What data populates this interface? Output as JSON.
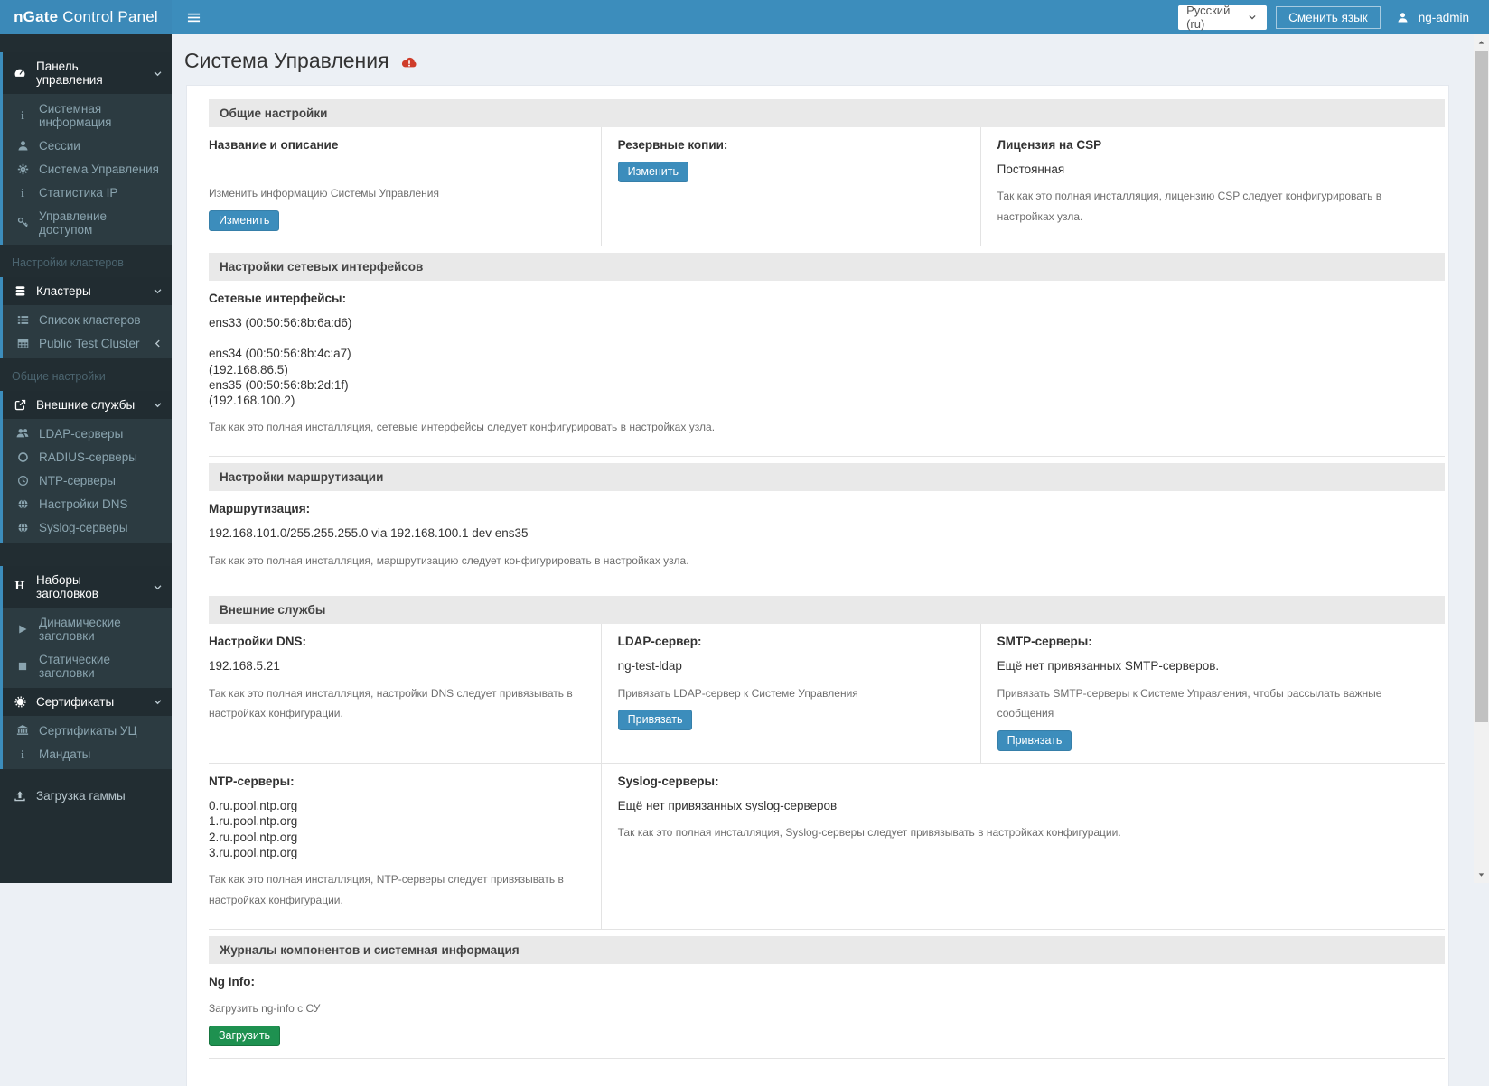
{
  "navbar": {
    "brand_bold": "nGate",
    "brand_rest": "Control Panel",
    "language_select_value": "Русский (ru)",
    "change_language_label": "Сменить язык",
    "username": "ng-admin"
  },
  "icons": {
    "menu": "hamburger-menu",
    "title_status": "red-cloud-warning",
    "navbar_user": "person-silhouette"
  },
  "sidebar": {
    "dashboard": {
      "label": "Панель управления",
      "items": [
        "Системная информация",
        "Сессии",
        "Система Управления",
        "Статистика IP",
        "Управление доступом"
      ]
    },
    "clusters_header": "Настройки кластеров",
    "clusters": {
      "label": "Кластеры",
      "items": [
        "Список кластеров",
        "Public Test Cluster"
      ]
    },
    "general_header": "Общие настройки",
    "external": {
      "label": "Внешние службы",
      "items": [
        "LDAP-серверы",
        "RADIUS-серверы",
        "NTP-серверы",
        "Настройки DNS",
        "Syslog-серверы"
      ]
    },
    "header_sets": {
      "label": "Наборы заголовков",
      "items": [
        "Динамические заголовки",
        "Статические заголовки"
      ]
    },
    "certificates": {
      "label": "Сертификаты",
      "items": [
        "Сертификаты УЦ",
        "Мандаты"
      ]
    },
    "gamma_upload": "Загрузка гаммы"
  },
  "page": {
    "title": "Система Управления"
  },
  "sections": {
    "general": {
      "header": "Общие настройки",
      "name_desc": {
        "title": "Название и описание",
        "hint": "Изменить информацию Системы Управления",
        "button": "Изменить"
      },
      "backups": {
        "title": "Резервные копии:",
        "button": "Изменить"
      },
      "csp_license": {
        "title": "Лицензия на CSP",
        "value": "Постоянная",
        "note": "Так как это полная инсталляция, лицензию CSP следует конфигурировать в настройках узла."
      }
    },
    "network": {
      "header": "Настройки сетевых интерфейсов",
      "title": "Сетевые интерфейсы:",
      "interfaces": "ens33 (00:50:56:8b:6a:d6)\n\nens34 (00:50:56:8b:4c:a7)\n(192.168.86.5)\nens35 (00:50:56:8b:2d:1f)\n(192.168.100.2)",
      "note": "Так как это полная инсталляция, сетевые интерфейсы следует конфигурировать в настройках узла."
    },
    "routing": {
      "header": "Настройки маршрутизации",
      "title": "Маршрутизация:",
      "route": "192.168.101.0/255.255.255.0 via 192.168.100.1 dev ens35",
      "note": "Так как это полная инсталляция, маршрутизацию следует конфигурировать в настройках узла."
    },
    "external_services": {
      "header": "Внешние службы",
      "dns": {
        "title": "Настройки DNS:",
        "value": "192.168.5.21",
        "note": "Так как это полная инсталляция, настройки DNS следует привязывать в настройках конфигурации."
      },
      "ldap": {
        "title": "LDAP-сервер:",
        "value": "ng-test-ldap",
        "note": "Привязать LDAP-сервер к Системе Управления",
        "button": "Привязать"
      },
      "smtp": {
        "title": "SMTP-серверы:",
        "value": "Ещё нет привязанных SMTP-серверов.",
        "note": "Привязать SMTP-серверы к Системе Управления, чтобы рассылать важные сообщения",
        "button": "Привязать"
      },
      "ntp": {
        "title": "NTP-серверы:",
        "servers": "0.ru.pool.ntp.org\n1.ru.pool.ntp.org\n2.ru.pool.ntp.org\n3.ru.pool.ntp.org",
        "note": "Так как это полная инсталляция, NTP-серверы следует привязывать в настройках конфигурации."
      },
      "syslog": {
        "title": "Syslog-серверы:",
        "value": "Ещё нет привязанных syslog-серверов",
        "note": "Так как это полная инсталляция, Syslog-серверы следует привязывать в настройках конфигурации."
      }
    },
    "logs": {
      "header": "Журналы компонентов и системная информация",
      "ng_info": {
        "title": "Ng Info:",
        "hint": "Загрузить ng-info с СУ",
        "button": "Загрузить"
      }
    }
  },
  "colors": {
    "accent": "#3c8dbc",
    "success": "#1e9150",
    "danger": "#cf3c2a"
  }
}
